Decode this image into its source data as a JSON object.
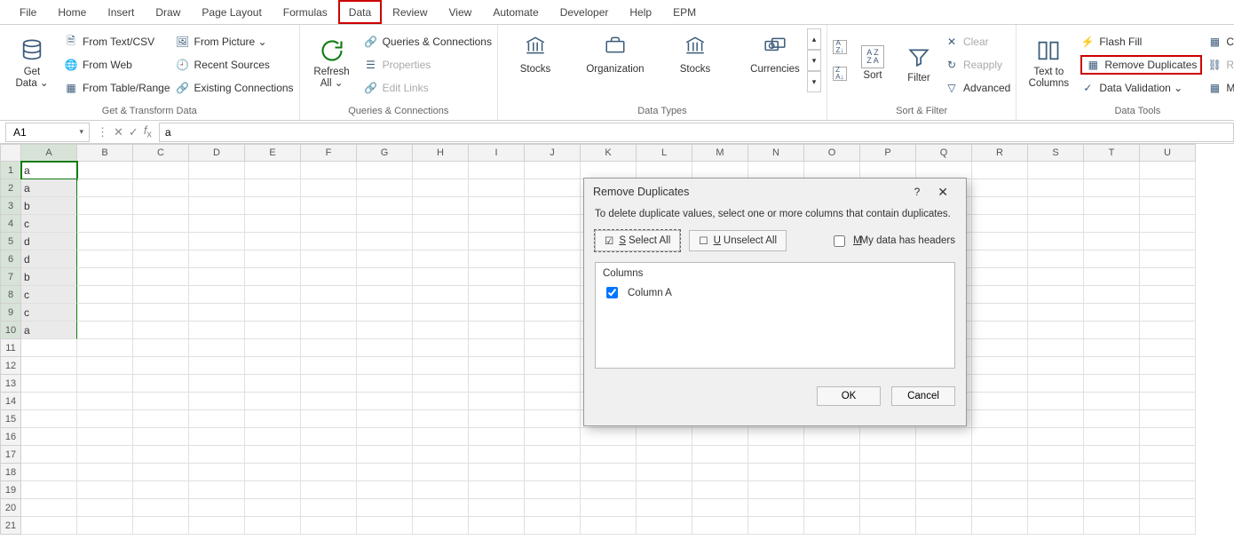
{
  "tabs": [
    "File",
    "Home",
    "Insert",
    "Draw",
    "Page Layout",
    "Formulas",
    "Data",
    "Review",
    "View",
    "Automate",
    "Developer",
    "Help",
    "EPM"
  ],
  "active_tab": "Data",
  "ribbon": {
    "get_data": {
      "big": "Get\nData ⌄",
      "items": [
        "From Text/CSV",
        "From Web",
        "From Table/Range",
        "From Picture ⌄",
        "Recent Sources",
        "Existing Connections"
      ],
      "label": "Get & Transform Data"
    },
    "refresh": {
      "big": "Refresh\nAll ⌄",
      "items": [
        "Queries & Connections",
        "Properties",
        "Edit Links"
      ],
      "label": "Queries & Connections"
    },
    "types": {
      "items": [
        "Stocks",
        "Organization",
        "Stocks",
        "Currencies"
      ],
      "label": "Data Types"
    },
    "sortfilter": {
      "sort_big": "Sort",
      "filter_big": "Filter",
      "items": [
        "Clear",
        "Reapply",
        "Advanced"
      ],
      "label": "Sort & Filter"
    },
    "texttools": {
      "big": "Text to\nColumns",
      "items": [
        "Flash Fill",
        "Remove Duplicates",
        "Data Validation   ⌄",
        "Cons",
        "Relat",
        "Mana"
      ],
      "label": "Data Tools"
    }
  },
  "namebox": "A1",
  "formula": "a",
  "columns": [
    "A",
    "B",
    "C",
    "D",
    "E",
    "F",
    "G",
    "H",
    "I",
    "J",
    "K",
    "L",
    "M",
    "N",
    "O",
    "P",
    "Q",
    "R",
    "S",
    "T",
    "U"
  ],
  "row_count": 21,
  "cells": {
    "1": "a",
    "2": "a",
    "3": "b",
    "4": "c",
    "5": "d",
    "6": "d",
    "7": "b",
    "8": "c",
    "9": "c",
    "10": "a"
  },
  "selected_rows": 10,
  "active_cell_row": 1,
  "dialog": {
    "title": "Remove Duplicates",
    "instr": "To delete duplicate values, select one or more columns that contain duplicates.",
    "select_all": "Select All",
    "unselect_all": "Unselect All",
    "headers_label": "My data has headers",
    "headers_checked": false,
    "list_header": "Columns",
    "columns": [
      {
        "label": "Column A",
        "checked": true
      }
    ],
    "ok": "OK",
    "cancel": "Cancel"
  }
}
